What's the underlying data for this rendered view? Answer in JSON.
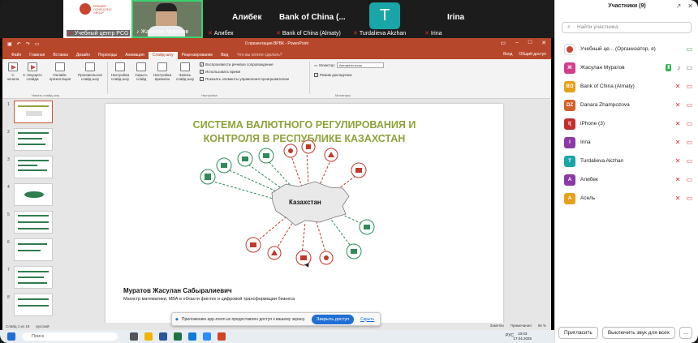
{
  "video": {
    "tiles": [
      {
        "name": "Учебный центр PCG",
        "logo": "PREMIER CONSULTING GROUP"
      },
      {
        "name": "Жасулан Муратов"
      },
      {
        "name": "Алибек",
        "bigname": "Алибек"
      },
      {
        "name": "Bank of China (Almaty)",
        "bigname": "Bank of China (..."
      },
      {
        "name": "Turdalieva Akzhan",
        "avatar": "T"
      },
      {
        "name": "Irina",
        "bigname": "Irina"
      }
    ]
  },
  "ppt": {
    "titlebar": "0 презентация ВРВК - PowerPoint",
    "menu": [
      "Файл",
      "Главная",
      "Вставка",
      "Дизайн",
      "Переходы",
      "Анимация",
      "Слайд-шоу",
      "Рецензирование",
      "Вид"
    ],
    "active_menu": "Слайд-шоу",
    "tell": "Что вы хотите сделать?",
    "signin": "Вход",
    "share": "Общий доступ",
    "ribbon": {
      "btn_from_start": "С начала",
      "btn_from_current": "С текущего слайда",
      "btn_online": "Онлайн-презентация",
      "btn_custom": "Произвольное слайд-шоу",
      "group_start": "Начать слайд-шоу",
      "btn_setup": "Настройка слайд-шоу",
      "btn_hide": "Скрыть слайд",
      "btn_timing": "Настройка времени",
      "btn_record": "Запись слайд-шоу",
      "chk_narration": "Воспроизвести речевое сопровождение",
      "chk_timing": "Использовать время",
      "chk_controls": "Показать элементы управления проигрывателем",
      "group_setup": "Настройка",
      "monitor_label": "Монитор:",
      "monitor_value": "Автоматически",
      "chk_presenter": "Режим докладчика",
      "group_monitors": "Мониторы"
    },
    "thumb_numbers": [
      "1",
      "2",
      "3",
      "4",
      "5",
      "6",
      "7",
      "8"
    ],
    "slide": {
      "title_line1": "СИСТЕМА ВАЛЮТНОГО РЕГУЛИРОВАНИЯ И",
      "title_line2": "КОНТРОЛЯ В РЕСПУБЛИКЕ КАЗАХСТАН",
      "map_label": "Казахстан",
      "author": "Муратов Жасулан Сабыралиевич",
      "author_sub": "Магистр математики, МВА в области финтех и цифровой трансформации бизнеса",
      "accent_color": "#8ea23a",
      "icon_colors": [
        "#2e8b57",
        "#c0392b"
      ]
    },
    "status": {
      "slide": "Слайд 1 из 19",
      "lang": "русский",
      "notes": "Заметки",
      "comments": "Примечания",
      "zoom": "66 %"
    }
  },
  "notification": {
    "text": "Приложению app.zoom.us предоставлен доступ к вашему экрану.",
    "button": "Закрыть доступ",
    "hide": "Скрыть"
  },
  "taskbar": {
    "search": "Поиск",
    "time": "10:03",
    "date": "17.04.2025",
    "lang": "РУС"
  },
  "participants": {
    "title": "Участники (9)",
    "search_placeholder": "Найти участника",
    "list": [
      {
        "initial": "",
        "name": "Учебный це... (Организатор, я)",
        "color": "#ffffff"
      },
      {
        "initial": "Ж",
        "name": "Жасулан Муратов",
        "color": "#d23e8a"
      },
      {
        "initial": "BO",
        "name": "Bank of China (Almaty)",
        "color": "#e6a118"
      },
      {
        "initial": "DZ",
        "name": "Danara Zhampozova",
        "color": "#d4602a"
      },
      {
        "initial": "I(",
        "name": "iPhone (3)",
        "color": "#c22e2e"
      },
      {
        "initial": "I",
        "name": "Irina",
        "color": "#8b3aa8"
      },
      {
        "initial": "T",
        "name": "Turdalieva Akzhan",
        "color": "#1aa6a8"
      },
      {
        "initial": "А",
        "name": "Алибек",
        "color": "#8b3aa8"
      },
      {
        "initial": "А",
        "name": "Асель",
        "color": "#e6a118"
      }
    ],
    "invite": "Пригласить",
    "mute_all": "Выключить звук для всех"
  }
}
